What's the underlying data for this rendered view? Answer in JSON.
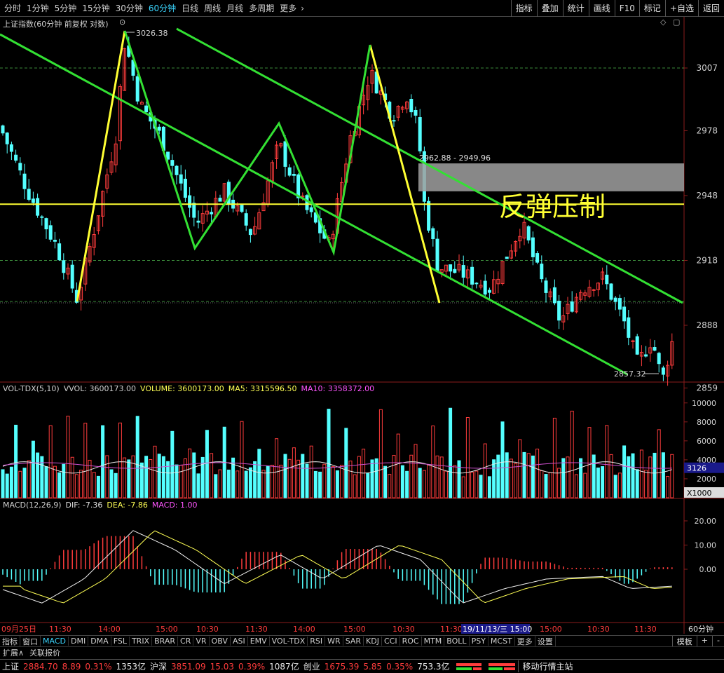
{
  "toolbar": {
    "periods": [
      "分时",
      "1分钟",
      "5分钟",
      "15分钟",
      "30分钟",
      "60分钟",
      "日线",
      "周线",
      "月线",
      "多周期",
      "更多"
    ],
    "active_period": "60分钟",
    "right_buttons": [
      "指标",
      "叠加",
      "统计",
      "画线",
      "F10",
      "标记",
      "+自选",
      "返回"
    ]
  },
  "main_panel": {
    "title": "上证指数(60分钟 前复权 对数)",
    "high_label": "3026.38",
    "low_label": "2857.32",
    "box_label": "2962.88 - 2949.96",
    "annotation": "反弹压制",
    "y_ticks": [
      "3007",
      "2978",
      "2948",
      "2918",
      "2888",
      "2859"
    ]
  },
  "volume_panel": {
    "title": "VOL-TDX(5,10)",
    "vvol": "VVOL: 3600173.00",
    "volume": "VOLUME: 3600173.00",
    "ma5": "MA5: 3315596.50",
    "ma10": "MA10: 3358372.00",
    "y_ticks": [
      "10000",
      "8000",
      "6000",
      "4000",
      "2000"
    ],
    "current_badge": "3126",
    "multiplier": "X1000"
  },
  "macd_panel": {
    "title": "MACD(12,26,9)",
    "dif": "DIF: -7.36",
    "dea": "DEA: -7.86",
    "macd": "MACD: 1.00",
    "y_ticks": [
      "20.00",
      "10.00",
      "0.00"
    ]
  },
  "time_axis": {
    "labels": [
      "09月25日",
      "11:30",
      "14:00",
      "15:00",
      "10:30",
      "11:30",
      "14:00",
      "15:00",
      "10:30",
      "11:30",
      "19/11/13/三 15:00",
      "15:00",
      "10:30",
      "11:30"
    ],
    "period_label": "60分钟"
  },
  "indicator_tabs": [
    "指标",
    "窗口",
    "MACD",
    "DMI",
    "DMA",
    "FSL",
    "TRIX",
    "BRAR",
    "CR",
    "VR",
    "OBV",
    "ASI",
    "EMV",
    "VOL-TDX",
    "RSI",
    "WR",
    "SAR",
    "KDJ",
    "CCI",
    "ROC",
    "MTM",
    "BOLL",
    "PSY",
    "MCST",
    "更多",
    "设置"
  ],
  "active_indicator": "MACD",
  "template_label": "模板",
  "expand_label": "扩展∧",
  "related_label": "关联报价",
  "status": {
    "sh_name": "上证",
    "sh_price": "2884.70",
    "sh_chg": "8.89",
    "sh_pct": "0.31%",
    "sh_amt": "1353亿",
    "hs_name": "沪深",
    "hs_price": "3851.09",
    "hs_chg": "15.03",
    "hs_pct": "0.39%",
    "hs_amt": "1087亿",
    "cy_name": "创业",
    "cy_price": "1675.39",
    "cy_chg": "5.85",
    "cy_pct": "0.35%",
    "cy_amt": "753.3亿",
    "station": "移动行情主站"
  },
  "colors": {
    "up": "#ff3c3c",
    "down": "#54ffff",
    "trend_green": "#33e033",
    "trend_yellow": "#ffff33",
    "resistance_box": "#a0a0a0"
  }
}
